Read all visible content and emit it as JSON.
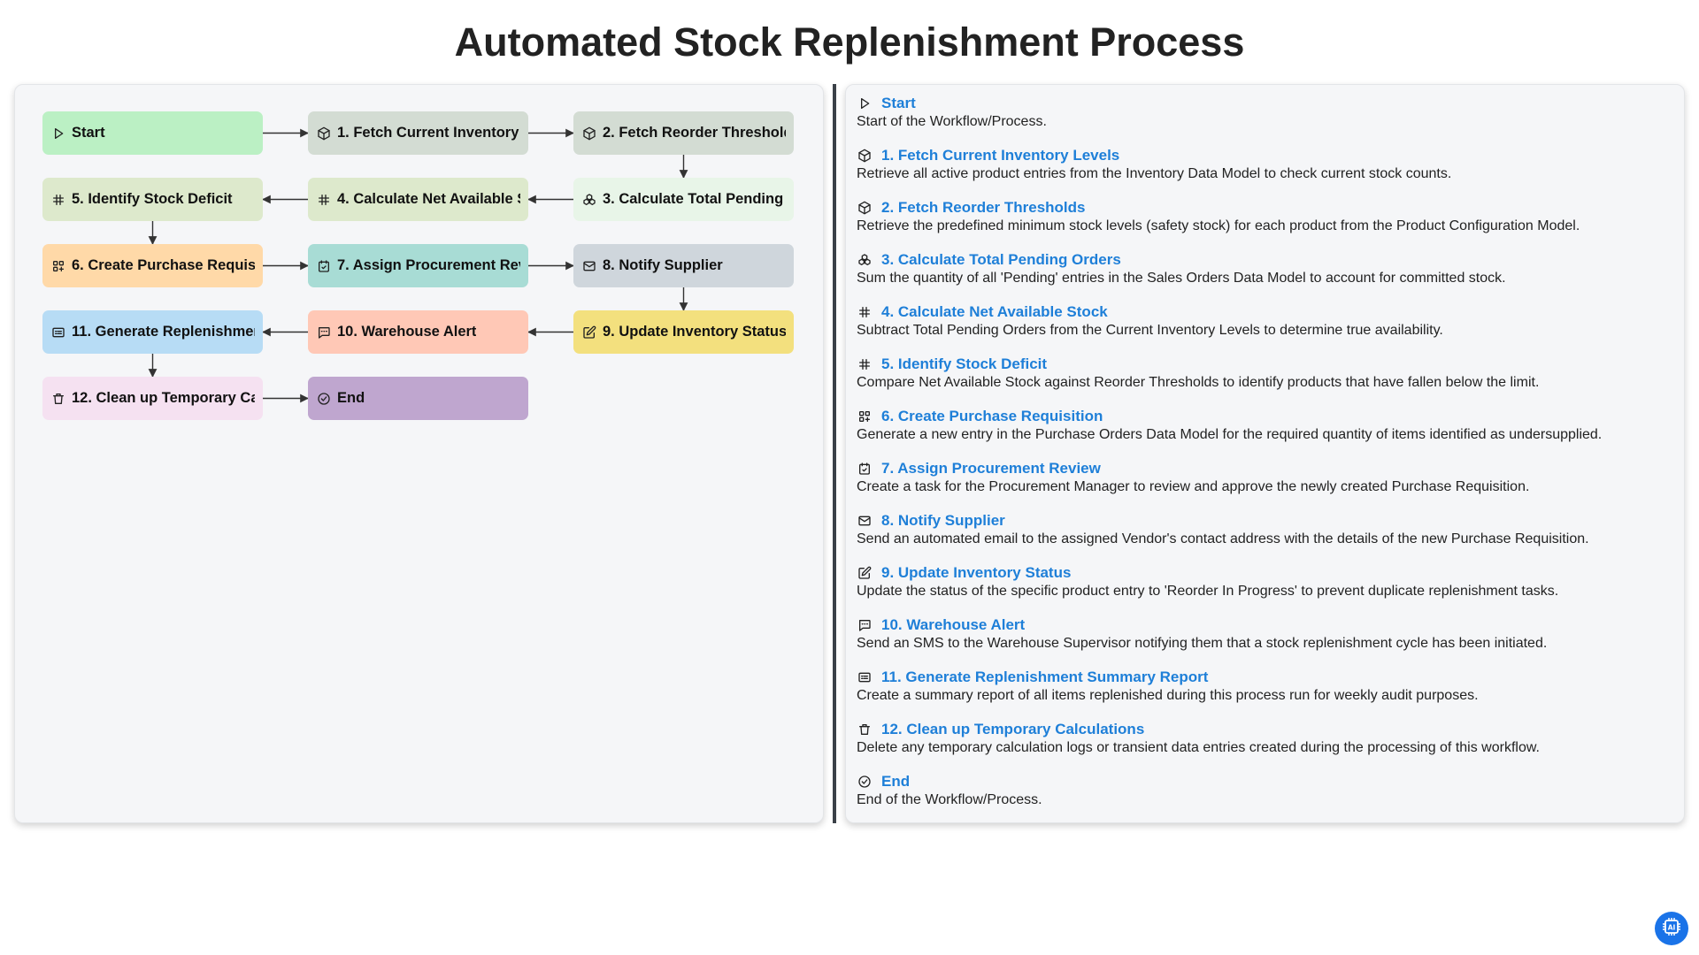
{
  "page": {
    "title": "Automated Stock Replenishment Process"
  },
  "colors": {
    "start": "#bbf0c4",
    "fetch": "#d3dcd3",
    "calc_light": "#e8f5e8",
    "calc": "#dde9cc",
    "requisition": "#ffd9a8",
    "review": "#a8dcd5",
    "notify": "#cfd6dc",
    "update": "#f3e07e",
    "alert": "#ffc8b6",
    "report": "#b7dcf5",
    "cleanup": "#f5e1f1",
    "end": "#bfa6cf",
    "link": "#1e7fd8"
  },
  "nodes": [
    {
      "id": "start",
      "label": "Start",
      "icon": "play-icon",
      "color": "#bbf0c4"
    },
    {
      "id": "n1",
      "label": "1. Fetch Current Inventory Levels",
      "icon": "cube-icon",
      "color": "#d3dcd3"
    },
    {
      "id": "n2",
      "label": "2. Fetch Reorder Thresholds",
      "icon": "cube-icon",
      "color": "#d3dcd3"
    },
    {
      "id": "n3",
      "label": "3. Calculate Total Pending Orders",
      "icon": "cubes-icon",
      "color": "#e8f5e8"
    },
    {
      "id": "n4",
      "label": "4. Calculate Net Available Stock",
      "icon": "hash-icon",
      "color": "#dde9cc"
    },
    {
      "id": "n5",
      "label": "5. Identify Stock Deficit",
      "icon": "hash-icon",
      "color": "#dde9cc"
    },
    {
      "id": "n6",
      "label": "6. Create Purchase Requisition",
      "icon": "grid-plus-icon",
      "color": "#ffd9a8"
    },
    {
      "id": "n7",
      "label": "7. Assign Procurement Review",
      "icon": "calendar-check-icon",
      "color": "#a8dcd5"
    },
    {
      "id": "n8",
      "label": "8. Notify Supplier",
      "icon": "mail-icon",
      "color": "#cfd6dc"
    },
    {
      "id": "n9",
      "label": "9. Update Inventory Status",
      "icon": "edit-icon",
      "color": "#f3e07e"
    },
    {
      "id": "n10",
      "label": "10. Warehouse Alert",
      "icon": "sms-icon",
      "color": "#ffc8b6"
    },
    {
      "id": "n11",
      "label": "11. Generate Replenishment Summary Report",
      "icon": "report-icon",
      "color": "#b7dcf5"
    },
    {
      "id": "n12",
      "label": "12. Clean up Temporary Calculations",
      "icon": "trash-icon",
      "color": "#f5e1f1"
    },
    {
      "id": "end",
      "label": "End",
      "icon": "check-circle-icon",
      "color": "#bfa6cf"
    }
  ],
  "details": [
    {
      "title": "Start",
      "icon": "play-icon",
      "desc": "Start of the Workflow/Process."
    },
    {
      "title": "1. Fetch Current Inventory Levels",
      "icon": "cube-icon",
      "desc": "Retrieve all active product entries from the Inventory Data Model to check current stock counts."
    },
    {
      "title": "2. Fetch Reorder Thresholds",
      "icon": "cube-icon",
      "desc": "Retrieve the predefined minimum stock levels (safety stock) for each product from the Product Configuration Model."
    },
    {
      "title": "3. Calculate Total Pending Orders",
      "icon": "cubes-icon",
      "desc": "Sum the quantity of all 'Pending' entries in the Sales Orders Data Model to account for committed stock."
    },
    {
      "title": "4. Calculate Net Available Stock",
      "icon": "hash-icon",
      "desc": "Subtract Total Pending Orders from the Current Inventory Levels to determine true availability."
    },
    {
      "title": "5. Identify Stock Deficit",
      "icon": "hash-icon",
      "desc": "Compare Net Available Stock against Reorder Thresholds to identify products that have fallen below the limit."
    },
    {
      "title": "6. Create Purchase Requisition",
      "icon": "grid-plus-icon",
      "desc": "Generate a new entry in the Purchase Orders Data Model for the required quantity of items identified as undersupplied."
    },
    {
      "title": "7. Assign Procurement Review",
      "icon": "calendar-check-icon",
      "desc": "Create a task for the Procurement Manager to review and approve the newly created Purchase Requisition."
    },
    {
      "title": "8. Notify Supplier",
      "icon": "mail-icon",
      "desc": "Send an automated email to the assigned Vendor's contact address with the details of the new Purchase Requisition."
    },
    {
      "title": "9. Update Inventory Status",
      "icon": "edit-icon",
      "desc": "Update the status of the specific product entry to 'Reorder In Progress' to prevent duplicate replenishment tasks."
    },
    {
      "title": "10. Warehouse Alert",
      "icon": "sms-icon",
      "desc": "Send an SMS to the Warehouse Supervisor notifying them that a stock replenishment cycle has been initiated."
    },
    {
      "title": "11. Generate Replenishment Summary Report",
      "icon": "report-icon",
      "desc": "Create a summary report of all items replenished during this process run for weekly audit purposes."
    },
    {
      "title": "12. Clean up Temporary Calculations",
      "icon": "trash-icon",
      "desc": "Delete any temporary calculation logs or transient data entries created during the processing of this workflow."
    },
    {
      "title": "End",
      "icon": "check-circle-icon",
      "desc": "End of the Workflow/Process."
    }
  ],
  "edges": [
    [
      "start",
      "n1"
    ],
    [
      "n1",
      "n2"
    ],
    [
      "n2",
      "n3"
    ],
    [
      "n3",
      "n4"
    ],
    [
      "n4",
      "n5"
    ],
    [
      "n5",
      "n6"
    ],
    [
      "n6",
      "n7"
    ],
    [
      "n7",
      "n8"
    ],
    [
      "n8",
      "n9"
    ],
    [
      "n9",
      "n10"
    ],
    [
      "n10",
      "n11"
    ],
    [
      "n11",
      "n12"
    ],
    [
      "n12",
      "end"
    ]
  ],
  "badge": {
    "icon": "ai-chip-icon"
  }
}
